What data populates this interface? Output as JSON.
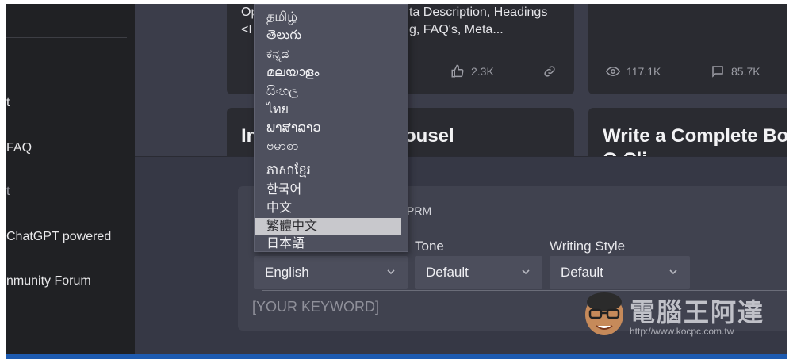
{
  "sidebar": {
    "items": [
      {
        "label": "t",
        "dim": false
      },
      {
        "label": "FAQ",
        "dim": false
      },
      {
        "label": "t",
        "dim": true
      },
      {
        "label": "ChatGPT powered",
        "dim": false
      },
      {
        "label": "nmunity Forum",
        "dim": false
      }
    ]
  },
  "cards": {
    "card1": {
      "line1": "Op",
      "line1_right": "ta Description, Headings",
      "line2": "<I",
      "line2_right": "g, FAQ's, Meta...",
      "likes": "2.3K"
    },
    "card2": {
      "views": "117.1K",
      "comments": "85.7K"
    },
    "card3": {
      "title_left": "In",
      "title_right": "ousel"
    },
    "card4": {
      "title": "Write a Complete Bo",
      "title_line2": "O   Cli"
    }
  },
  "form": {
    "link": "PRM",
    "language_label": "",
    "tone_label": "Tone",
    "style_label": "Writing Style",
    "language_value": "English",
    "tone_value": "Default",
    "style_value": "Default",
    "keyword_placeholder": "[YOUR KEYWORD]"
  },
  "dropdown": {
    "options": [
      "தமிழ்",
      "తెలుగు",
      "ಕನ್ನಡ",
      "മലയാളം",
      "සිංහල",
      "ไทย",
      "ພາສາລາວ",
      "ဗမာစာ",
      "ភាសាខ្មែរ",
      "한국어",
      "中文",
      "繁體中文",
      "日本語"
    ],
    "selected": "繁體中文"
  },
  "watermark": {
    "text": "電腦王阿達",
    "url": "http://www.kocpc.com.tw"
  },
  "colors": {
    "sidebar_bg": "#202124",
    "main_bg": "#3b3d4a",
    "card_bg": "#2a2b31",
    "accent_bar": "#1e5bb0"
  }
}
